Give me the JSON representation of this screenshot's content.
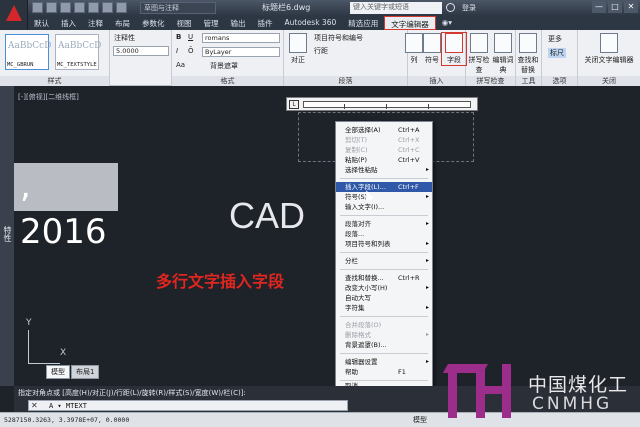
{
  "titlebar": {
    "workspace": "草图与注释",
    "doc_title": "标题栏6.dwg",
    "search_placeholder": "键入关键字或短语",
    "login": "登录",
    "win_min": "—",
    "win_max": "□",
    "win_close": "✕"
  },
  "tabs": [
    "默认",
    "插入",
    "注释",
    "布局",
    "参数化",
    "视图",
    "管理",
    "输出",
    "插件",
    "Autodesk 360",
    "精选应用",
    "文字编辑器",
    "◉▾"
  ],
  "ribbon": {
    "style_panel": {
      "title": "样式",
      "styles": [
        {
          "preview": "AaBbCcD",
          "name": "MC_GBRUN"
        },
        {
          "preview": "AaBbCcD",
          "name": "MC_TEXTSTYLE"
        }
      ],
      "annotative": "注释性",
      "height": "5.0000"
    },
    "format_panel": {
      "title": "格式",
      "bold": "B",
      "italic": "I",
      "underline": "U",
      "overline": "Ō",
      "font": "romans",
      "color": "ByLayer",
      "bgmask": "背景遮罩",
      "case": "Aa"
    },
    "para_panel": {
      "title": "段落",
      "justify": "对正",
      "bullets": "项目符号和编号",
      "linespacing": "行距"
    },
    "insert_panel": {
      "title": "插入",
      "columns": "列",
      "symbol": "符号",
      "field": "字段"
    },
    "spell_panel": {
      "title": "拼写检查",
      "spellcheck": "拼写检查",
      "dictionary": "编辑词典"
    },
    "tools_panel": {
      "title": "工具",
      "findreplace": "查找和替换"
    },
    "options_panel": {
      "title": "选项",
      "more": "更多",
      "ruler": "标尺"
    },
    "close_panel": {
      "title": "关闭",
      "close_editor": "关闭文字编辑器"
    }
  },
  "left_strip": "特性",
  "canvas": {
    "view_label": "[-][俯视][二维线框]",
    "year_text": ", 2016",
    "cad_text": "CAD",
    "caption": "多行文字插入字段",
    "ucs_y": "Y",
    "ucs_x": "X",
    "layout_tabs": [
      "模型",
      "布局1"
    ]
  },
  "ruler": {
    "l_button": "L"
  },
  "context_menu": {
    "items": [
      {
        "label": "全部选择(A)",
        "shortcut": "Ctrl+A",
        "state": "normal"
      },
      {
        "label": "剪切(T)",
        "shortcut": "Ctrl+X",
        "state": "disabled"
      },
      {
        "label": "复制(C)",
        "shortcut": "Ctrl+C",
        "state": "disabled"
      },
      {
        "label": "粘贴(P)",
        "shortcut": "Ctrl+V",
        "state": "normal"
      },
      {
        "label": "选择性粘贴",
        "shortcut": "",
        "state": "normal",
        "submenu": true
      },
      {
        "label": "插入字段(L)...",
        "shortcut": "Ctrl+F",
        "state": "highlighted"
      },
      {
        "label": "符号(S)",
        "shortcut": "",
        "state": "normal",
        "submenu": true
      },
      {
        "label": "输入文字(I)...",
        "shortcut": "",
        "state": "normal"
      },
      {
        "label": "段落对齐",
        "shortcut": "",
        "state": "normal",
        "submenu": true
      },
      {
        "label": "段落...",
        "shortcut": "",
        "state": "normal"
      },
      {
        "label": "项目符号和列表",
        "shortcut": "",
        "state": "normal",
        "submenu": true
      },
      {
        "label": "分栏",
        "shortcut": "",
        "state": "normal",
        "submenu": true
      },
      {
        "label": "查找和替换...",
        "shortcut": "Ctrl+R",
        "state": "normal"
      },
      {
        "label": "改变大小写(H)",
        "shortcut": "",
        "state": "normal",
        "submenu": true
      },
      {
        "label": "自动大写",
        "shortcut": "",
        "state": "normal"
      },
      {
        "label": "字符集",
        "shortcut": "",
        "state": "normal",
        "submenu": true
      },
      {
        "label": "合并段落(O)",
        "shortcut": "",
        "state": "disabled"
      },
      {
        "label": "删除格式",
        "shortcut": "",
        "state": "disabled",
        "submenu": true
      },
      {
        "label": "背景遮罩(B)...",
        "shortcut": "",
        "state": "normal"
      },
      {
        "label": "编辑器设置",
        "shortcut": "",
        "state": "normal",
        "submenu": true
      },
      {
        "label": "帮助",
        "shortcut": "F1",
        "state": "normal"
      },
      {
        "label": "取消",
        "shortcut": "",
        "state": "normal"
      }
    ]
  },
  "command": {
    "history": "指定对角点或 [高度(H)/对正(J)/行距(L)/旋转(R)/样式(S)/宽度(W)/栏(C)]:",
    "close_x": "✕",
    "prompt": "A ▾ MTEXT"
  },
  "status": {
    "coords": "5287150.3263, 3.3978E+07, 0.0000",
    "model": "模型"
  },
  "watermark": {
    "zh": "中国煤化工",
    "en": "CNMHG"
  },
  "colors": {
    "accent_red": "#e0261f",
    "menu_highlight": "#2f59a8",
    "watermark_purple": "#9d2d8a"
  }
}
